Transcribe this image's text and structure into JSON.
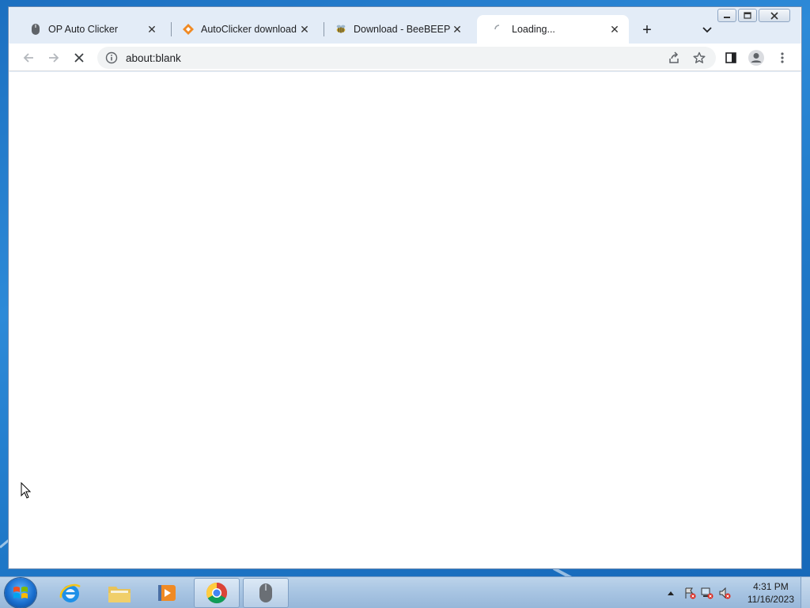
{
  "browser": {
    "tabs": [
      {
        "title": "OP Auto Clicker",
        "icon": "mouse-favicon",
        "active": false
      },
      {
        "title": "AutoClicker download | ",
        "icon": "orange-diamond-favicon",
        "active": false
      },
      {
        "title": "Download - BeeBEEP - F",
        "icon": "bee-favicon",
        "active": false
      },
      {
        "title": "Loading...",
        "icon": "loading-spinner",
        "active": true
      }
    ],
    "new_tab_label": "+",
    "address": "about:blank"
  },
  "taskbar": {
    "apps": [
      "internet-explorer",
      "windows-explorer",
      "media-player",
      "chrome",
      "auto-clicker"
    ],
    "clock_time": "4:31 PM",
    "clock_date": "11/16/2023"
  }
}
